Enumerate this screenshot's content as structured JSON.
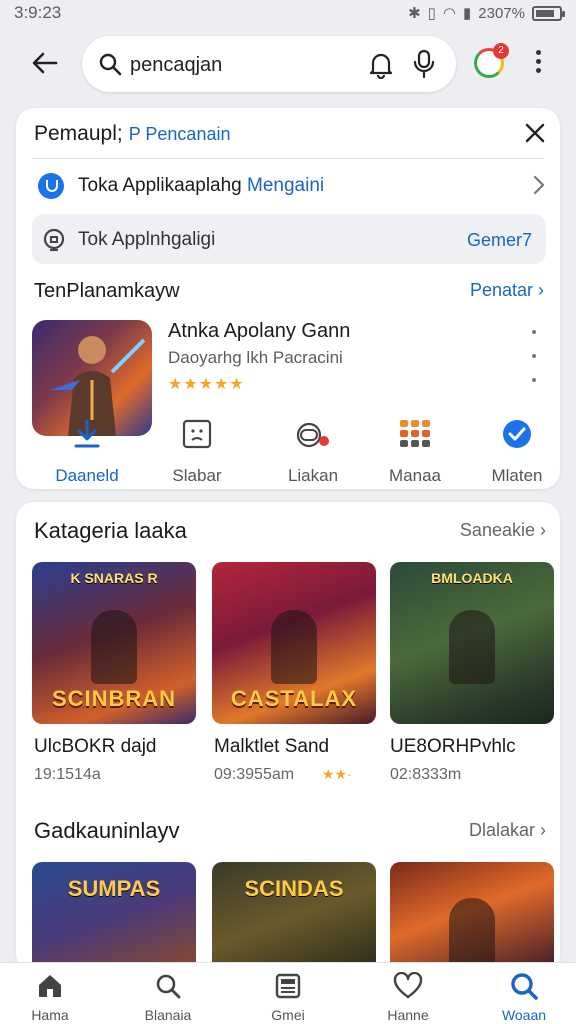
{
  "status": {
    "time": "3:9:23",
    "battery": "2307%",
    "battery_level": 0.8
  },
  "search": {
    "query": "pencaqjan"
  },
  "avatar_badge": "2",
  "card1": {
    "title": "Pemaupl;",
    "title_link": "P Pencanain",
    "store_row": {
      "label": "Toka Applikaaplahg",
      "link": "Mengaini"
    },
    "pill_row": {
      "label": "Tok Applnhgaligi",
      "value": "Gemer7"
    },
    "section_title": "TenPlanamkayw",
    "section_link": "Penatar",
    "game": {
      "title": "Atnka Apolany Gann",
      "subtitle": "Daoyarhg lkh Pacracini",
      "stars": "★★★★★"
    },
    "actions": [
      {
        "label": "Daaneld",
        "icon": "download-icon"
      },
      {
        "label": "Slabar",
        "icon": "face-icon"
      },
      {
        "label": "Liakan",
        "icon": "gamepad-icon"
      },
      {
        "label": "Manaa",
        "icon": "grid-icon"
      },
      {
        "label": "Mlaten",
        "icon": "verified-icon"
      }
    ]
  },
  "card2": {
    "section1": {
      "title": "Katageria laaka",
      "link": "Saneakie"
    },
    "tiles1": [
      {
        "art_top": "K SNARAS R",
        "art_word": "SCINBRAN",
        "name": "UlcBOKR dajd",
        "meta": "19:1514a",
        "stars": ""
      },
      {
        "art_top": "",
        "art_word": "CASTALAX",
        "name": "Malktlet Sand",
        "meta": "09:3955am",
        "stars": "★★·"
      },
      {
        "art_top": "BMLOADKA",
        "art_word": "",
        "name": "UE8ORHPvhlc",
        "meta": "02:8333m",
        "stars": ""
      }
    ],
    "section2": {
      "title": "Gadkauninlayv",
      "link": "Dlalakar"
    },
    "tiles2": [
      {
        "art_word": "SUMPAS"
      },
      {
        "art_word": "SCINDAS"
      },
      {
        "art_word": ""
      }
    ]
  },
  "bottom_nav": [
    {
      "label": "Hama",
      "icon": "home-icon"
    },
    {
      "label": "Blanaia",
      "icon": "search-icon"
    },
    {
      "label": "Gmei",
      "icon": "news-icon"
    },
    {
      "label": "Hanne",
      "icon": "heart-icon"
    },
    {
      "label": "Woaan",
      "icon": "search-active-icon",
      "active": true
    }
  ]
}
